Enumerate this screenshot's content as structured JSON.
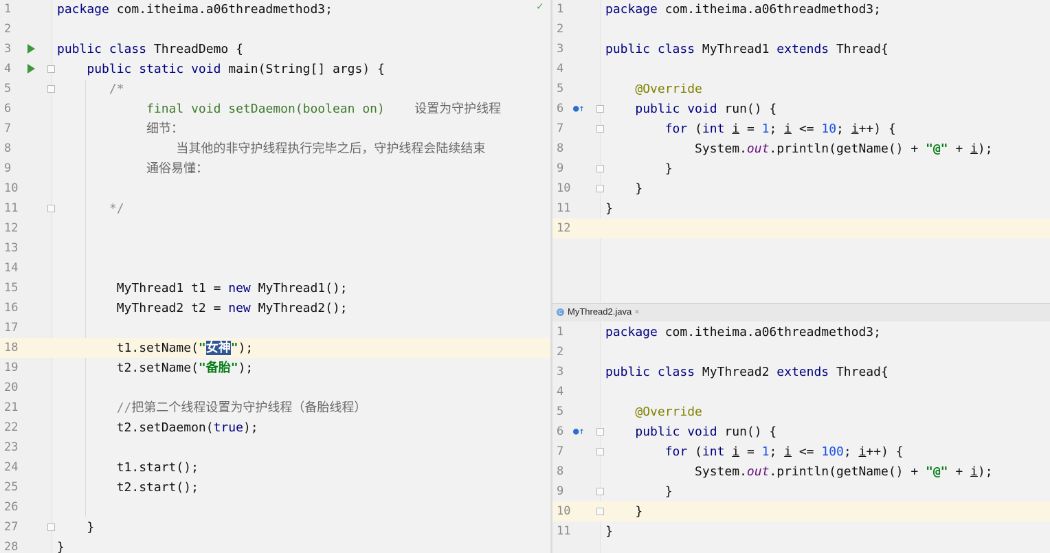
{
  "left_editor": {
    "lines": [
      {
        "n": "1",
        "html": "<span class='kw'>package</span> com.itheima.a06threadmethod3;"
      },
      {
        "n": "2",
        "html": ""
      },
      {
        "n": "3",
        "html": "<span class='kw'>public class</span> ThreadDemo {",
        "run": true
      },
      {
        "n": "4",
        "html": "    <span class='kw'>public static void</span> main(String[] args) {",
        "run": true,
        "fold": true
      },
      {
        "n": "5",
        "html": "       <span class='cm'>/*</span>",
        "fold": true
      },
      {
        "n": "6",
        "html": "            <span class='doc'>final void setDaemon(boolean on)</span>    <span class='cmz'>设置为守护线程</span>"
      },
      {
        "n": "7",
        "html": "            <span class='cmz'>细节：</span>"
      },
      {
        "n": "8",
        "html": "                <span class='cmz'>当其他的非守护线程执行完毕之后，守护线程会陆续结束</span>"
      },
      {
        "n": "9",
        "html": "            <span class='cmz'>通俗易懂：</span>"
      },
      {
        "n": "10",
        "html": ""
      },
      {
        "n": "11",
        "html": "       <span class='cm'>*/</span>",
        "fold": true
      },
      {
        "n": "12",
        "html": ""
      },
      {
        "n": "13",
        "html": ""
      },
      {
        "n": "14",
        "html": ""
      },
      {
        "n": "15",
        "html": "        MyThread1 t1 = <span class='kw'>new</span> MyThread1();"
      },
      {
        "n": "16",
        "html": "        MyThread2 t2 = <span class='kw'>new</span> MyThread2();"
      },
      {
        "n": "17",
        "html": ""
      },
      {
        "n": "18",
        "html": "        t1.setName(<span class='str'>\"<span class='sel'>女神</span>\"</span>);",
        "hl": true
      },
      {
        "n": "19",
        "html": "        t2.setName(<span class='str'>\"备胎\"</span>);"
      },
      {
        "n": "20",
        "html": ""
      },
      {
        "n": "21",
        "html": "        <span class='cm'>//<span class='cmz'>把第二个线程设置为守护线程（备胎线程）</span></span>"
      },
      {
        "n": "22",
        "html": "        t2.setDaemon(<span class='kw'>true</span>);"
      },
      {
        "n": "23",
        "html": ""
      },
      {
        "n": "24",
        "html": "        t1.start();"
      },
      {
        "n": "25",
        "html": "        t2.start();"
      },
      {
        "n": "26",
        "html": ""
      },
      {
        "n": "27",
        "html": "    }",
        "fold": true
      },
      {
        "n": "28",
        "html": "}"
      }
    ]
  },
  "top_right_editor": {
    "lines": [
      {
        "n": "1",
        "html": "<span class='kw'>package</span> com.itheima.a06threadmethod3;"
      },
      {
        "n": "2",
        "html": ""
      },
      {
        "n": "3",
        "html": "<span class='kw'>public class</span> MyThread1 <span class='kw'>extends</span> Thread{"
      },
      {
        "n": "4",
        "html": ""
      },
      {
        "n": "5",
        "html": "    <span class='ann'>@Override</span>"
      },
      {
        "n": "6",
        "html": "    <span class='kw'>public void</span> run() {",
        "ovr": true,
        "fold": true
      },
      {
        "n": "7",
        "html": "        <span class='kw'>for</span> (<span class='kw'>int</span> <span class='ul'>i</span> = <span class='num-lit'>1</span>; <span class='ul'>i</span> &lt;= <span class='num-lit'>10</span>; <span class='ul'>i</span>++) {",
        "fold": true
      },
      {
        "n": "8",
        "html": "            System.<span class='field'>out</span>.println(getName() + <span class='str'>\"@\"</span> + <span class='ul'>i</span>);"
      },
      {
        "n": "9",
        "html": "        }",
        "fold": true
      },
      {
        "n": "10",
        "html": "    }",
        "fold": true
      },
      {
        "n": "11",
        "html": "}"
      },
      {
        "n": "12",
        "html": "",
        "hl": true
      }
    ]
  },
  "tab": {
    "label": "MyThread2.java",
    "close": "×",
    "icon": "C"
  },
  "bottom_right_editor": {
    "lines": [
      {
        "n": "1",
        "html": "<span class='kw'>package</span> com.itheima.a06threadmethod3;"
      },
      {
        "n": "2",
        "html": ""
      },
      {
        "n": "3",
        "html": "<span class='kw'>public class</span> MyThread2 <span class='kw'>extends</span> Thread{"
      },
      {
        "n": "4",
        "html": ""
      },
      {
        "n": "5",
        "html": "    <span class='ann'>@Override</span>"
      },
      {
        "n": "6",
        "html": "    <span class='kw'>public void</span> run() {",
        "ovr": true,
        "fold": true
      },
      {
        "n": "7",
        "html": "        <span class='kw'>for</span> (<span class='kw'>int</span> <span class='ul'>i</span> = <span class='num-lit'>1</span>; <span class='ul'>i</span> &lt;= <span class='num-lit'>100</span>; <span class='ul'>i</span>++) {",
        "fold": true
      },
      {
        "n": "8",
        "html": "            System.<span class='field'>out</span>.println(getName() + <span class='str'>\"@\"</span> + <span class='ul'>i</span>);"
      },
      {
        "n": "9",
        "html": "        }",
        "fold": true
      },
      {
        "n": "10",
        "html": "    }",
        "fold": true,
        "hl": true
      },
      {
        "n": "11",
        "html": "}"
      }
    ]
  },
  "status": {
    "check": "✓"
  }
}
